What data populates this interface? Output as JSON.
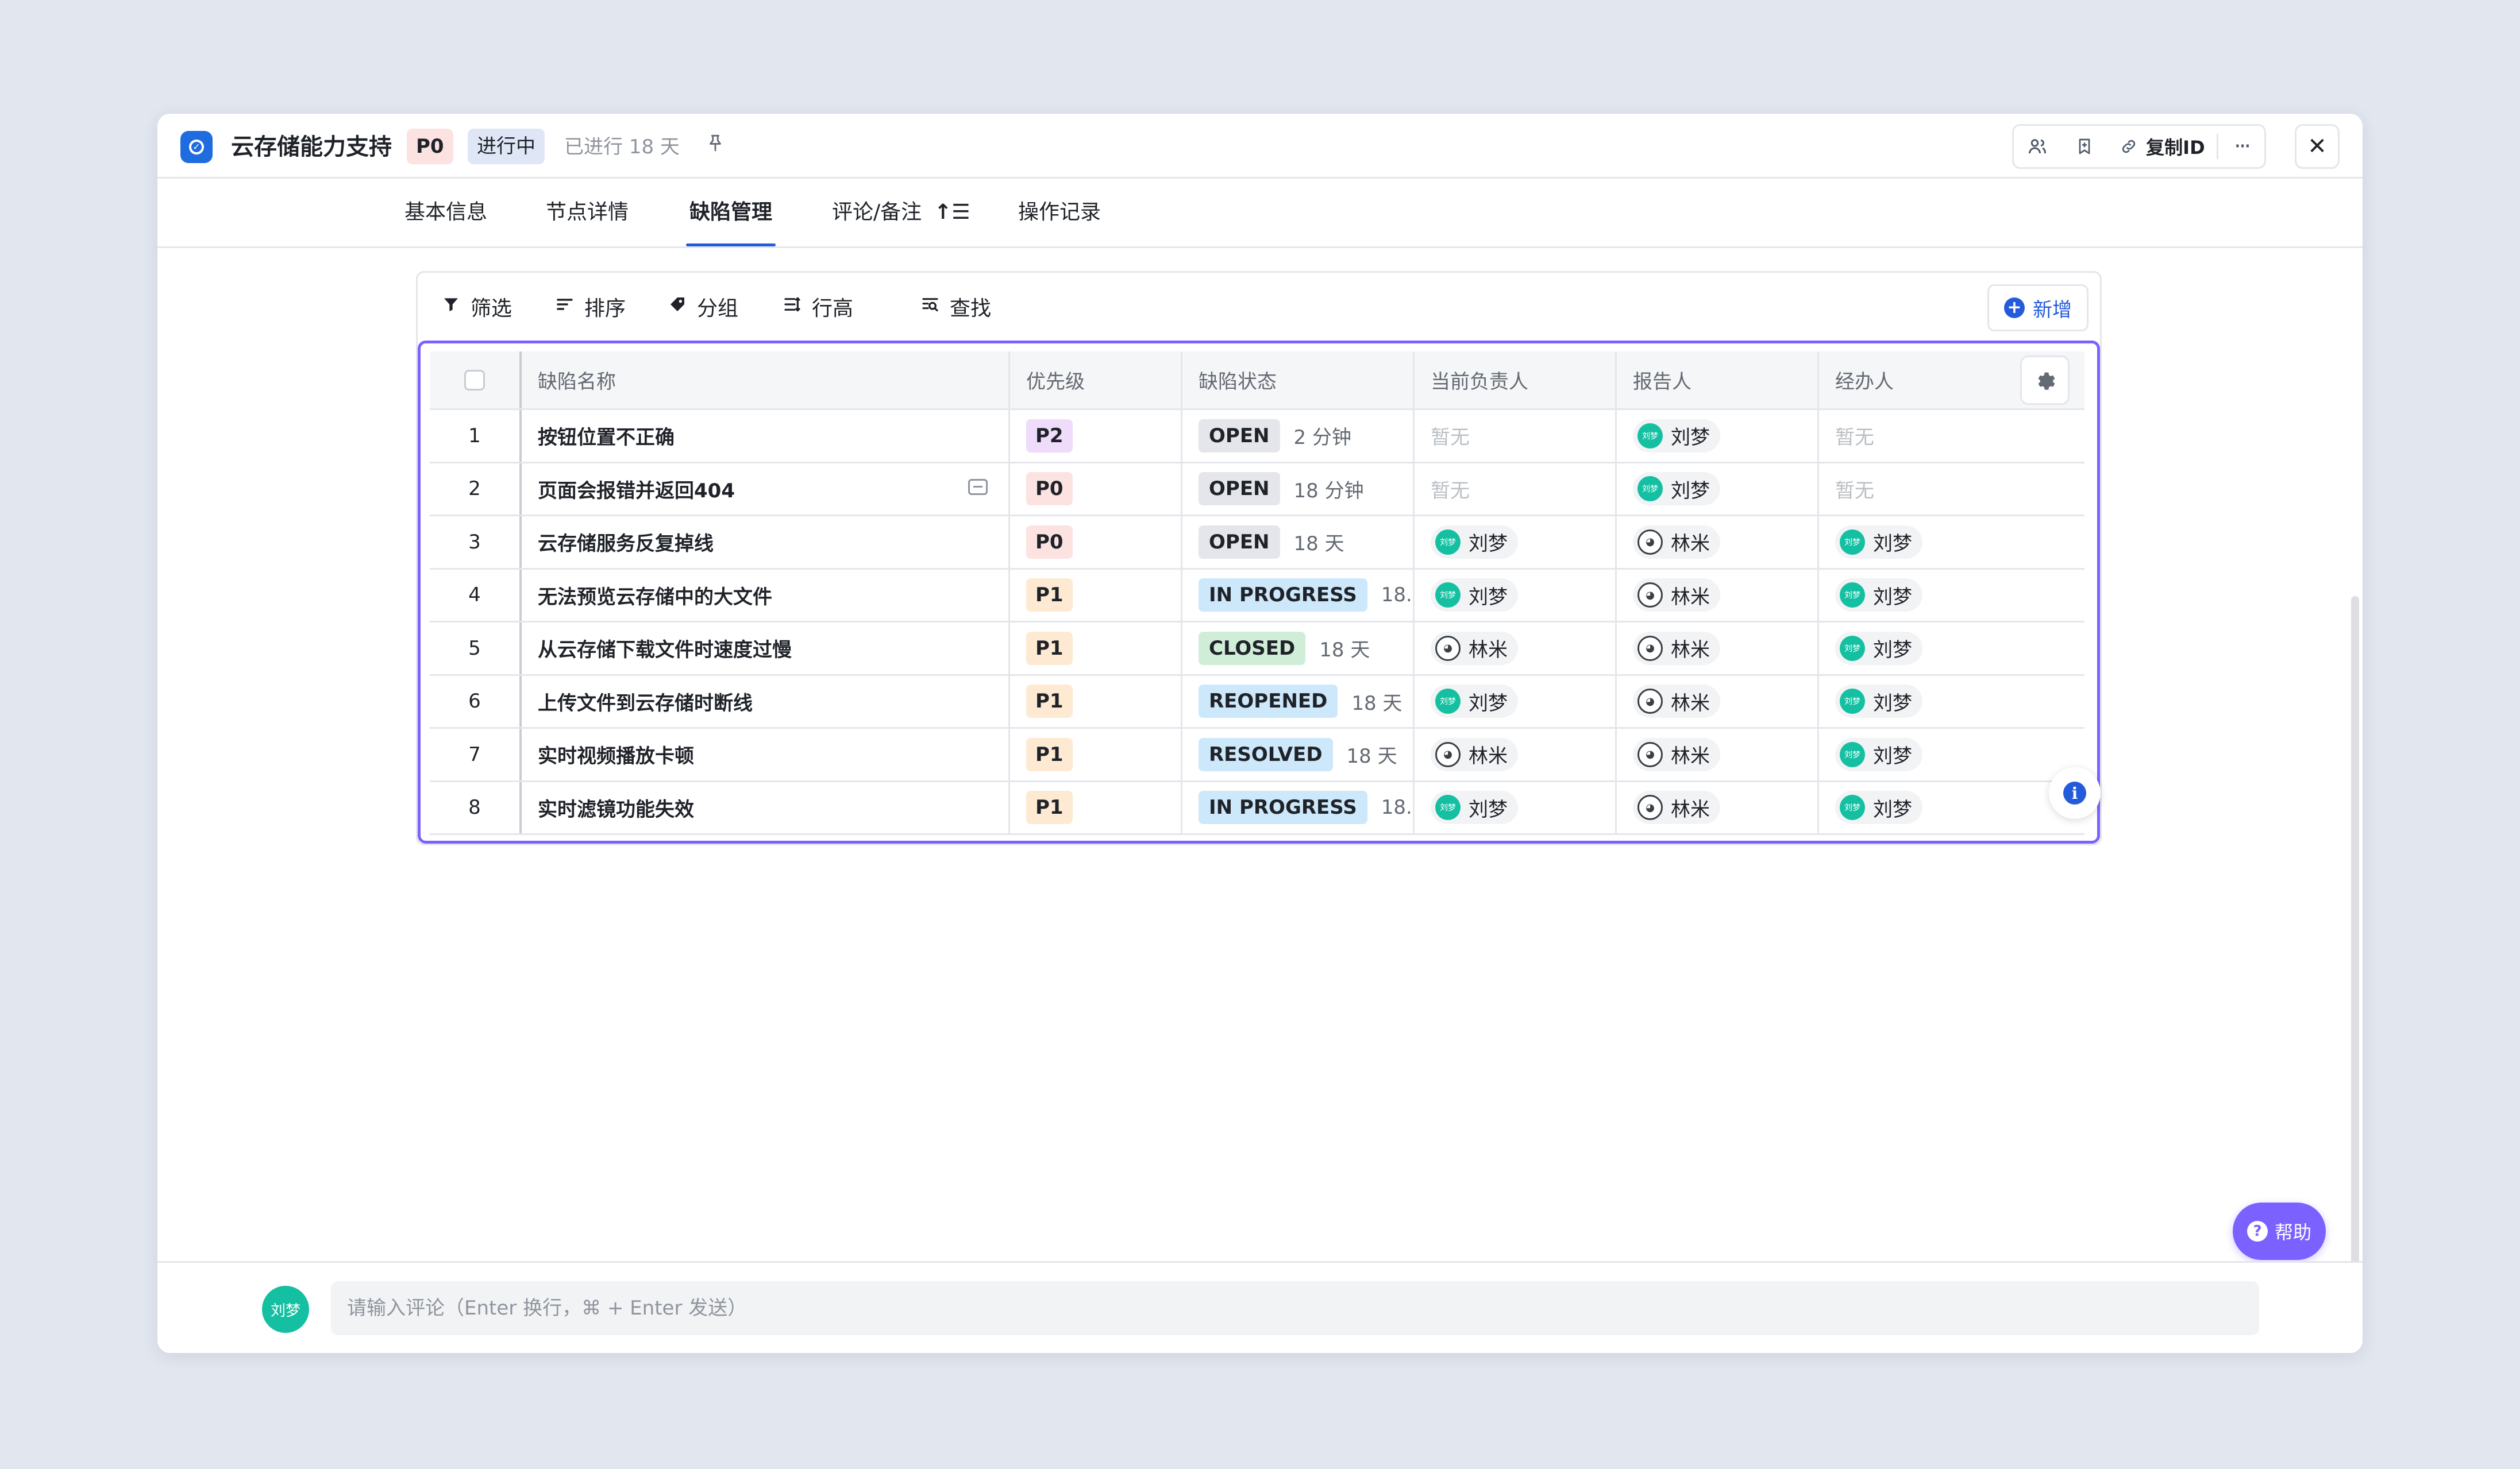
{
  "header": {
    "title": "云存储能力支持",
    "priority": "P0",
    "status": "进行中",
    "elapsed": "已进行 18 天",
    "copy_id_label": "复制ID",
    "icons": [
      "check-circle-icon",
      "pin-icon",
      "members-icon",
      "bookmark-icon",
      "link-icon",
      "more-icon",
      "close-icon"
    ]
  },
  "tabs": [
    {
      "label": "基本信息"
    },
    {
      "label": "节点详情"
    },
    {
      "label": "缺陷管理",
      "active": true
    },
    {
      "label": "评论/备注"
    },
    {
      "label": "操作记录"
    }
  ],
  "toolbar": {
    "filter": "筛选",
    "sort": "排序",
    "group": "分组",
    "row_height": "行高",
    "find": "查找",
    "add": "新增"
  },
  "table": {
    "columns": [
      "缺陷名称",
      "优先级",
      "缺陷状态",
      "当前负责人",
      "报告人",
      "经办人"
    ],
    "empty_text": "暂无",
    "rows": [
      {
        "index": "1",
        "name": "按钮位置不正确",
        "priority": "P2",
        "status": "OPEN",
        "status_class": "st-open",
        "duration": "2 分钟",
        "assignee": "",
        "reporter": "刘梦",
        "handler": "",
        "has_comment": false
      },
      {
        "index": "2",
        "name": "页面会报错并返回404",
        "priority": "P0",
        "status": "OPEN",
        "status_class": "st-open",
        "duration": "18 分钟",
        "assignee": "",
        "reporter": "刘梦",
        "handler": "",
        "has_comment": true
      },
      {
        "index": "3",
        "name": "云存储服务反复掉线",
        "priority": "P0",
        "status": "OPEN",
        "status_class": "st-open",
        "duration": "18 天",
        "assignee": "刘梦",
        "reporter": "林米",
        "handler": "刘梦",
        "has_comment": false
      },
      {
        "index": "4",
        "name": "无法预览云存储中的大文件",
        "priority": "P1",
        "status": "IN PROGRESS",
        "status_class": "st-progress",
        "duration": "18...",
        "assignee": "刘梦",
        "reporter": "林米",
        "handler": "刘梦",
        "has_comment": false
      },
      {
        "index": "5",
        "name": "从云存储下载文件时速度过慢",
        "priority": "P1",
        "status": "CLOSED",
        "status_class": "st-closed",
        "duration": "18 天",
        "assignee": "林米",
        "reporter": "林米",
        "handler": "刘梦",
        "has_comment": false
      },
      {
        "index": "6",
        "name": "上传文件到云存储时断线",
        "priority": "P1",
        "status": "REOPENED",
        "status_class": "st-reopened",
        "duration": "18 天",
        "assignee": "刘梦",
        "reporter": "林米",
        "handler": "刘梦",
        "has_comment": false
      },
      {
        "index": "7",
        "name": "实时视频播放卡顿",
        "priority": "P1",
        "status": "RESOLVED",
        "status_class": "st-resolved",
        "duration": "18 天",
        "assignee": "林米",
        "reporter": "林米",
        "handler": "刘梦",
        "has_comment": false
      },
      {
        "index": "8",
        "name": "实时滤镜功能失效",
        "priority": "P1",
        "status": "IN PROGRESS",
        "status_class": "st-progress",
        "duration": "18...",
        "assignee": "刘梦",
        "reporter": "林米",
        "handler": "刘梦",
        "has_comment": false
      }
    ]
  },
  "avatar_mini_label": "刘梦",
  "help_label": "帮助",
  "comment": {
    "avatar_label": "刘梦",
    "placeholder": "请输入评论（Enter 换行，⌘ + Enter 发送）"
  },
  "colors": {
    "accent": "#245bdb",
    "selection_border": "#7b61ff",
    "help_bg": "#7b61ff",
    "avatar_green": "#14c0a1"
  }
}
